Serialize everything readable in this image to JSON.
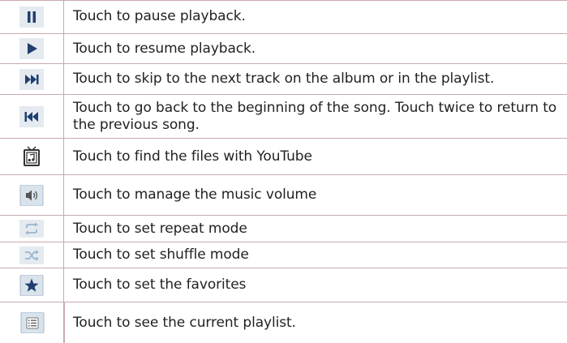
{
  "rows": [
    {
      "icon": "pause-icon",
      "text": "Touch to pause playback."
    },
    {
      "icon": "play-icon",
      "text": "Touch to resume playback."
    },
    {
      "icon": "skip-next-icon",
      "text": "Touch to skip to the next track on the album or in the playlist."
    },
    {
      "icon": "skip-previous-icon",
      "text": "Touch to go back to the beginning of the song. Touch twice to return to the previous song."
    },
    {
      "icon": "youtube-tv-icon",
      "text": "Touch to find the files with YouTube"
    },
    {
      "icon": "volume-icon",
      "text": "Touch to manage the music volume"
    },
    {
      "icon": "repeat-icon",
      "text": "Touch to set repeat mode"
    },
    {
      "icon": "shuffle-icon",
      "text": "Touch to set shuffle mode"
    },
    {
      "icon": "star-icon",
      "text": "Touch to set the favorites"
    },
    {
      "icon": "playlist-icon",
      "text": "Touch to see the current playlist."
    }
  ],
  "colors": {
    "rule": "#c9a9b3",
    "icon_dark": "#1f3f6e",
    "icon_light": "#9bb6cf",
    "icon_bg": "#dfe7ee"
  }
}
